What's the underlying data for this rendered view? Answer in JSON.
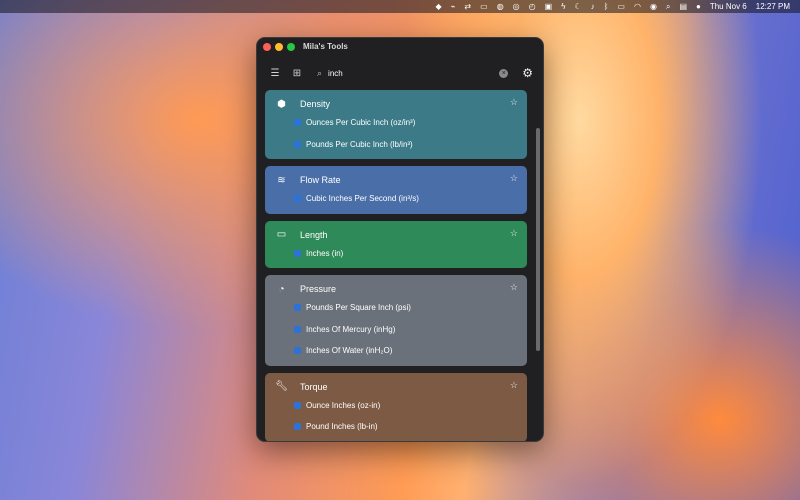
{
  "menubar": {
    "date": "Thu Nov 6",
    "time": "12:27 PM",
    "icons": [
      "dropbox-icon",
      "antenna-icon",
      "switch-icon",
      "display-icon",
      "globe-icon",
      "globe-icon",
      "timer-icon",
      "app-icon",
      "bolt-icon",
      "moon-icon",
      "volume-icon",
      "bluetooth-icon",
      "battery-icon",
      "wifi-icon",
      "user-icon",
      "search-icon",
      "control-center-icon",
      "siri-icon"
    ]
  },
  "window": {
    "title": "Mila's Tools"
  },
  "toolbar": {
    "search_value": "inch"
  },
  "categories": [
    {
      "name": "Density",
      "color": "#3b7a86",
      "icon": "cube-icon",
      "units": [
        "Ounces Per Cubic Inch (oz/in³)",
        "Pounds Per Cubic Inch (lb/in³)"
      ]
    },
    {
      "name": "Flow Rate",
      "color": "#4a6fa8",
      "icon": "wind-icon",
      "units": [
        "Cubic Inches Per Second (in³/s)"
      ]
    },
    {
      "name": "Length",
      "color": "#2f8a59",
      "icon": "ruler-icon",
      "units": [
        "Inches (in)"
      ]
    },
    {
      "name": "Pressure",
      "color": "#6b717a",
      "icon": "gauge-icon",
      "units": [
        "Pounds Per Square Inch (psi)",
        "Inches Of Mercury (inHg)",
        "Inches Of Water (inH₂O)"
      ]
    },
    {
      "name": "Torque",
      "color": "#7d5a44",
      "icon": "wrench-icon",
      "units": [
        "Ounce Inches (oz-in)",
        "Pound Inches (lb-in)"
      ]
    }
  ]
}
